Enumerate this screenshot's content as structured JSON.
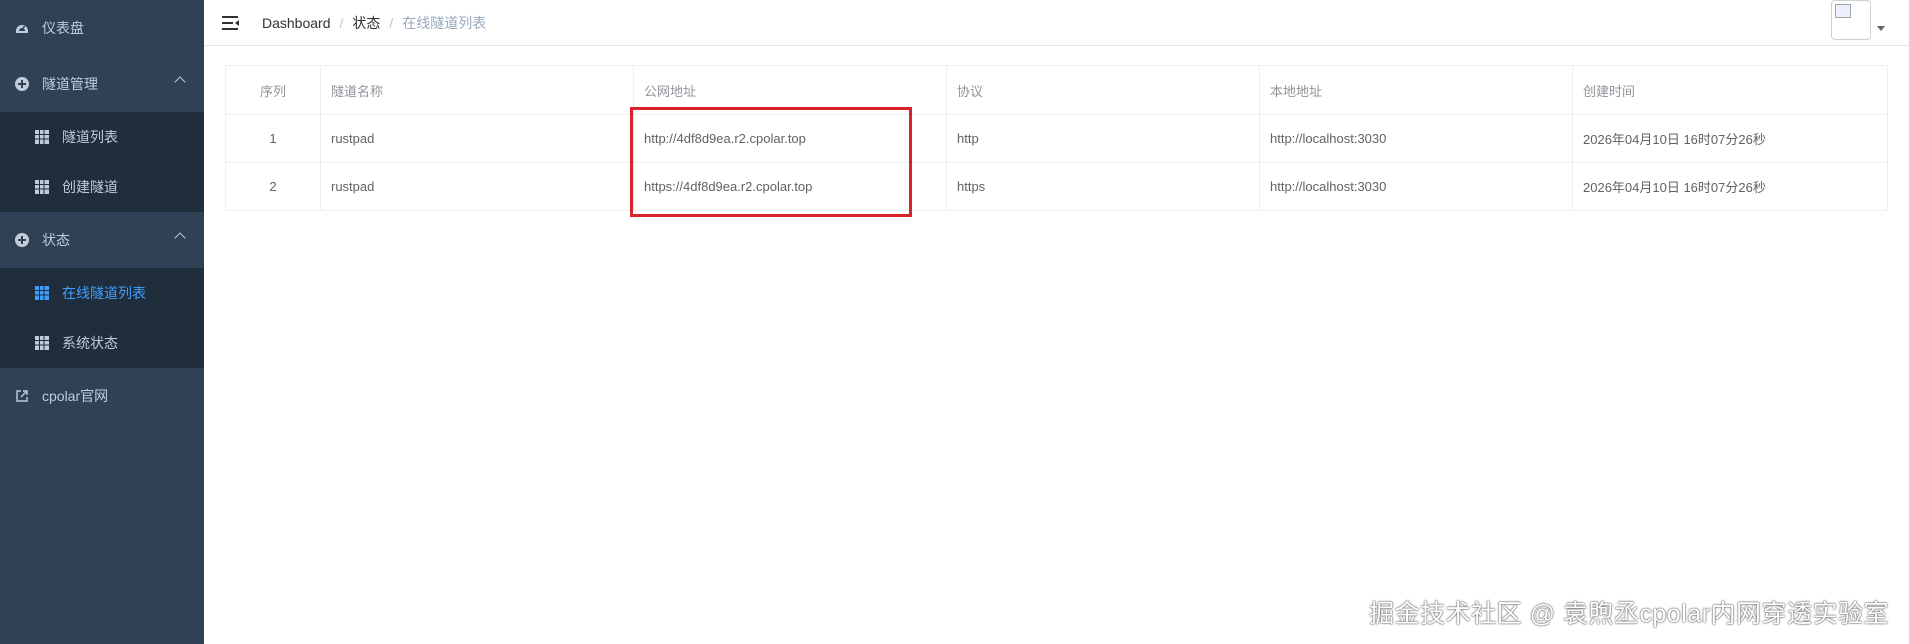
{
  "sidebar": {
    "dashboard": "仪表盘",
    "tunnel_mgmt": {
      "label": "隧道管理",
      "items": [
        "隧道列表",
        "创建隧道"
      ]
    },
    "status": {
      "label": "状态",
      "items": [
        "在线隧道列表",
        "系统状态"
      ]
    },
    "cpolar_site": "cpolar官网"
  },
  "header": {
    "breadcrumb": [
      "Dashboard",
      "状态",
      "在线隧道列表"
    ],
    "separator": "/"
  },
  "table": {
    "columns": [
      "序列",
      "隧道名称",
      "公网地址",
      "协议",
      "本地地址",
      "创建时间"
    ],
    "rows": [
      [
        "1",
        "rustpad",
        "http://4df8d9ea.r2.cpolar.top",
        "http",
        "http://localhost:3030",
        "2026年04月10日 16时07分26秒"
      ],
      [
        "2",
        "rustpad",
        "https://4df8d9ea.r2.cpolar.top",
        "https",
        "http://localhost:3030",
        "2026年04月10日 16时07分26秒"
      ]
    ]
  },
  "watermark": "掘金技术社区 @ 袁煦丞cpolar内网穿透实验室",
  "colors": {
    "sidebar_bg": "#304156",
    "submenu_bg": "#1f2d3d",
    "active": "#409eff",
    "highlight": "#d9232b"
  }
}
